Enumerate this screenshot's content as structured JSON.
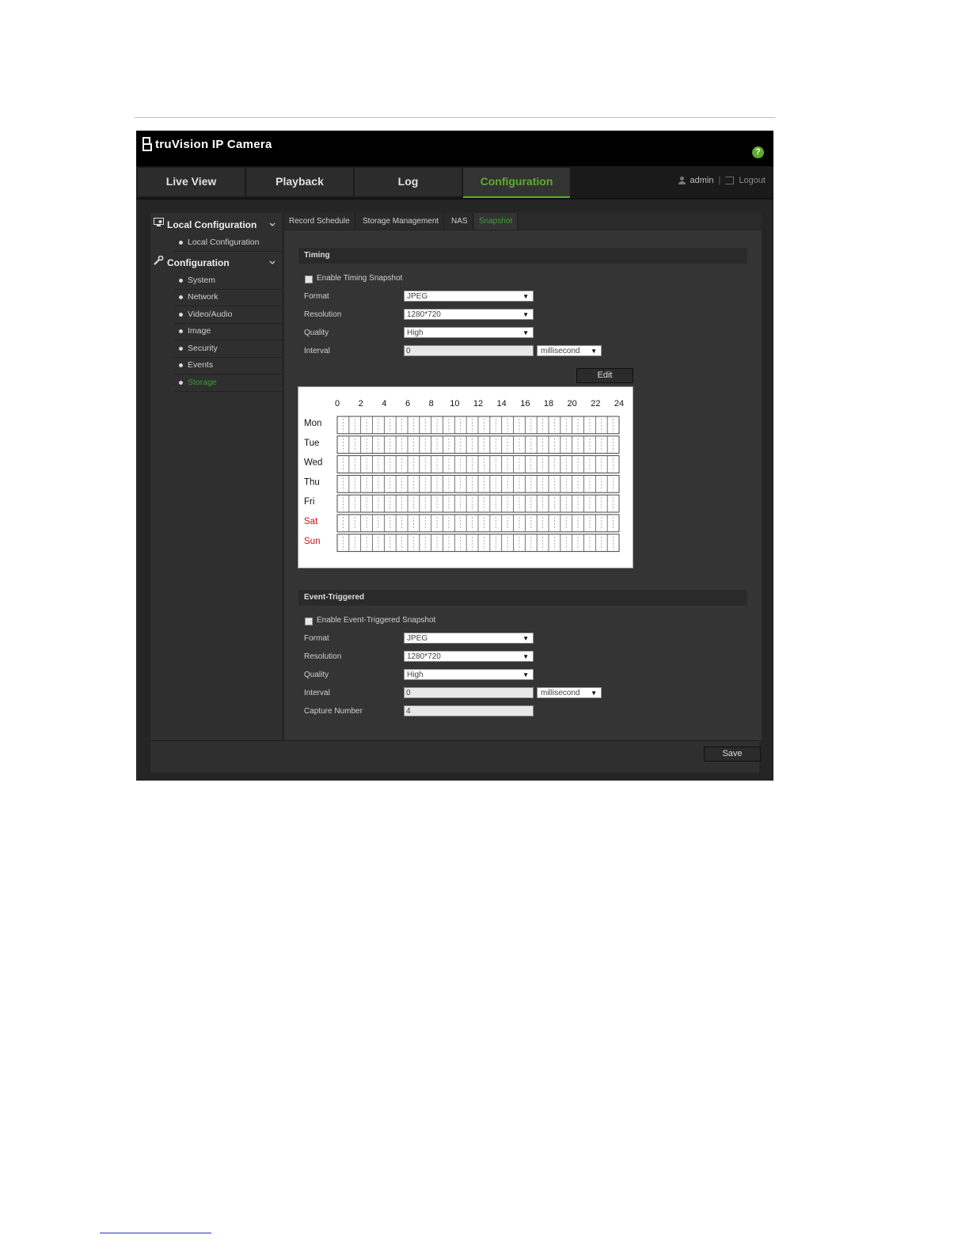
{
  "app": {
    "title": "truVision  IP Camera",
    "help_label": "?"
  },
  "nav": {
    "tabs": [
      {
        "label": "Live View"
      },
      {
        "label": "Playback"
      },
      {
        "label": "Log"
      },
      {
        "label": "Configuration"
      }
    ],
    "user": "admin",
    "separator": "|",
    "logout": "Logout"
  },
  "sidebar": {
    "groups": [
      {
        "label": "Local Configuration",
        "items": [
          "Local Configuration"
        ]
      },
      {
        "label": "Configuration",
        "items": [
          "System",
          "Network",
          "Video/Audio",
          "Image",
          "Security",
          "Events",
          "Storage"
        ]
      }
    ],
    "active_item": "Storage"
  },
  "subtabs": [
    "Record Schedule",
    "Storage Management",
    "NAS",
    "Snapshot"
  ],
  "timing": {
    "section_title": "Timing",
    "enable_label": "Enable Timing Snapshot",
    "format_label": "Format",
    "format_value": "JPEG",
    "resolution_label": "Resolution",
    "resolution_value": "1280*720",
    "quality_label": "Quality",
    "quality_value": "High",
    "interval_label": "Interval",
    "interval_value": "0",
    "interval_unit": "millisecond",
    "edit_button": "Edit"
  },
  "schedule": {
    "hours": [
      "0",
      "2",
      "4",
      "6",
      "8",
      "10",
      "12",
      "14",
      "16",
      "18",
      "20",
      "22",
      "24"
    ],
    "days": [
      "Mon",
      "Tue",
      "Wed",
      "Thu",
      "Fri",
      "Sat",
      "Sun"
    ],
    "weekend_color": "#cc1111"
  },
  "event": {
    "section_title": "Event-Triggered",
    "enable_label": "Enable Event-Triggered Snapshot",
    "format_label": "Format",
    "format_value": "JPEG",
    "resolution_label": "Resolution",
    "resolution_value": "1280*720",
    "quality_label": "Quality",
    "quality_value": "High",
    "interval_label": "Interval",
    "interval_value": "0",
    "interval_unit": "millisecond",
    "capture_label": "Capture Number",
    "capture_value": "4"
  },
  "footer": {
    "save_label": "Save"
  },
  "colors": {
    "accent": "#5dac2e",
    "active_text": "#3d9b35"
  }
}
